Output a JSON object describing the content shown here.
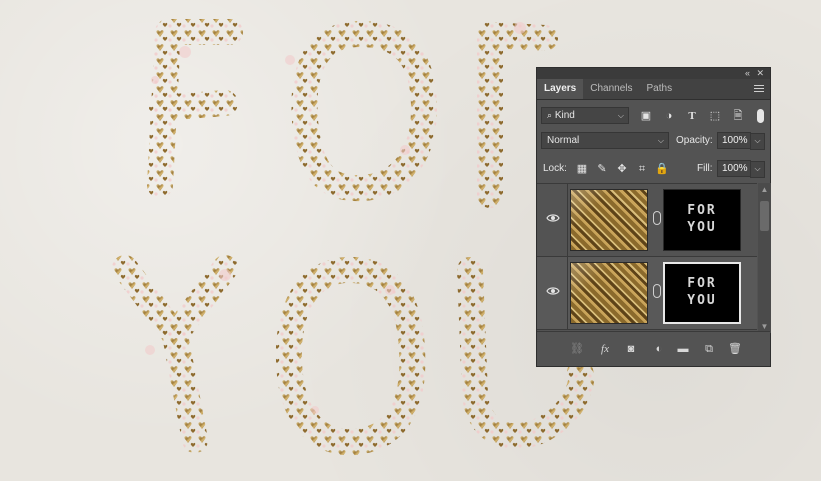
{
  "canvas": {
    "line1": "FOR",
    "line2": "YOU"
  },
  "panel": {
    "tabs": [
      "Layers",
      "Channels",
      "Paths"
    ],
    "filter": {
      "kind_label": "Kind"
    },
    "blend_mode": "Normal",
    "opacity_label": "Opacity:",
    "opacity_value": "100%",
    "lock_label": "Lock:",
    "fill_label": "Fill:",
    "fill_value": "100%",
    "layers": [
      {
        "mask_text_line1": "FOR",
        "mask_text_line2": "YOU",
        "selected": false
      },
      {
        "mask_text_line1": "FOR",
        "mask_text_line2": "YOU",
        "selected": true
      }
    ],
    "footer_icons": [
      "link-icon",
      "fx-icon",
      "add-mask-icon",
      "adjustment-icon",
      "group-folder-icon",
      "new-layer-icon",
      "trash-icon"
    ]
  },
  "colors": {
    "panel_bg": "#535353",
    "foil_gold": "#b8913f",
    "paper": "#e8e5df"
  }
}
